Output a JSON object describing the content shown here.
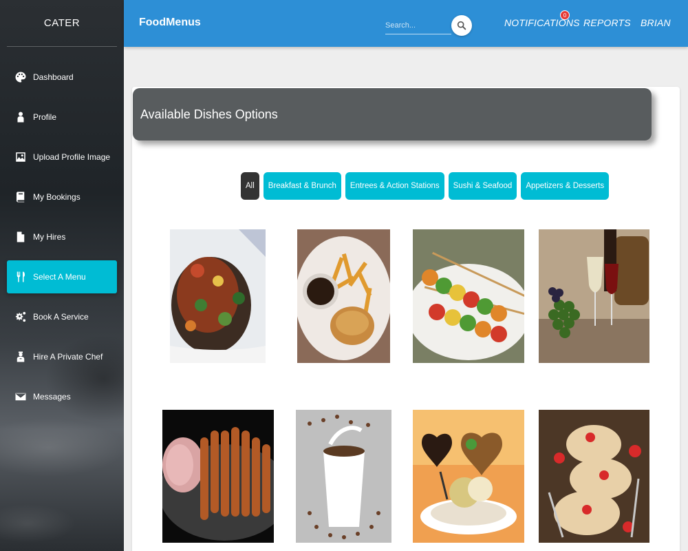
{
  "sidebar": {
    "brand": "CATER",
    "items": [
      {
        "label": "Dashboard",
        "icon": "palette-icon"
      },
      {
        "label": "Profile",
        "icon": "person-icon"
      },
      {
        "label": "Upload Profile Image",
        "icon": "image-icon"
      },
      {
        "label": "My Bookings",
        "icon": "book-icon"
      },
      {
        "label": "My Hires",
        "icon": "file-icon"
      },
      {
        "label": "Select A Menu",
        "icon": "cutlery-icon",
        "active": true
      },
      {
        "label": "Book A Service",
        "icon": "gears-icon"
      },
      {
        "label": "Hire A Private Chef",
        "icon": "chef-icon"
      },
      {
        "label": "Messages",
        "icon": "envelope-icon"
      }
    ]
  },
  "topbar": {
    "app_name": "FoodMenus",
    "search_placeholder": "Search...",
    "notifications_label": "NOTIFICATIONS",
    "notifications_count": "0",
    "reports_label": "REPORTS",
    "user_label": "BRIAN"
  },
  "main": {
    "title": "Available Dishes Options",
    "filters": [
      "All",
      "Breakfast & Brunch",
      "Entrees & Action Stations",
      "Sushi & Seafood",
      "Appetizers & Desserts"
    ],
    "dishes": [
      "stuffed-pepper-photo",
      "steak-fries-photo",
      "vegetable-skewers-photo",
      "grapes-wine-photo",
      "sausages-platter-photo",
      "coffee-cup-photo",
      "ice-cream-dessert-photo",
      "strawberry-pastry-photo"
    ]
  },
  "colors": {
    "topbar": "#2d8fd6",
    "accent": "#00bcd4",
    "sidebar": "#2b2f33",
    "header_card": "#585c5e",
    "active_filter": "#333333",
    "badge": "#e53935"
  }
}
